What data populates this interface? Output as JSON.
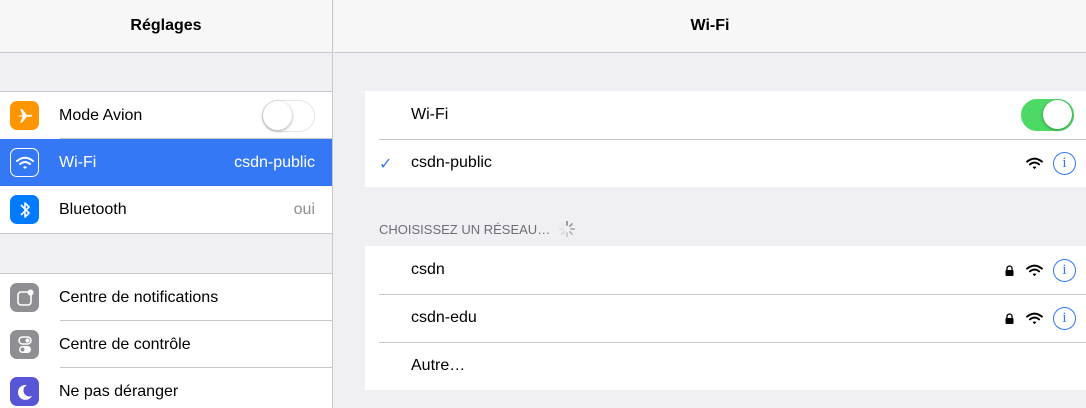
{
  "master": {
    "title": "Réglages",
    "group1": [
      {
        "label": "Mode Avion",
        "icon": "airplane-icon",
        "color": "#ff9500",
        "switch_on": false
      },
      {
        "label": "Wi-Fi",
        "value": "csdn-public",
        "icon": "wifi-icon",
        "color": "#3478f6",
        "selected": true
      },
      {
        "label": "Bluetooth",
        "value": "oui",
        "icon": "bluetooth-icon",
        "color": "#007aff"
      }
    ],
    "group2": [
      {
        "label": "Centre de notifications",
        "icon": "notifications-icon",
        "color": "#8e8e93"
      },
      {
        "label": "Centre de contrôle",
        "icon": "control-center-icon",
        "color": "#8e8e93"
      },
      {
        "label": "Ne pas déranger",
        "icon": "moon-icon",
        "color": "#5856d6"
      }
    ]
  },
  "detail": {
    "title": "Wi-Fi",
    "wifi_label": "Wi-Fi",
    "wifi_on": true,
    "connected_network": "csdn-public",
    "choose_header": "CHOISISSEZ UN RÉSEAU…",
    "networks": [
      {
        "name": "csdn",
        "locked": true
      },
      {
        "name": "csdn-edu",
        "locked": true
      }
    ],
    "other_label": "Autre…"
  },
  "colors": {
    "accent": "#3478f6",
    "switch_on": "#4cd964",
    "background": "#efeff4"
  }
}
